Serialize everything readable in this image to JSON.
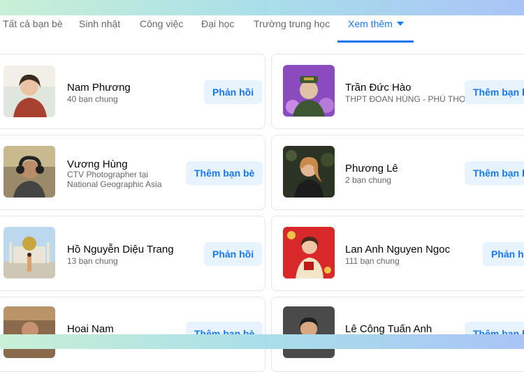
{
  "tabs": [
    {
      "label": "Tất cả bạn bè"
    },
    {
      "label": "Sinh nhật"
    },
    {
      "label": "Công việc"
    },
    {
      "label": "Đại học"
    },
    {
      "label": "Trường trung học"
    },
    {
      "label": "Xem thêm"
    }
  ],
  "colors": {
    "accent": "#1877f2",
    "button_bg": "#e7f3ff",
    "secondary_text": "#65676b"
  },
  "people": [
    {
      "name": "Nam Phương",
      "subtitle": "40 bạn chung",
      "button": "Phản hồi"
    },
    {
      "name": "Trần Đức Hào",
      "subtitle": "THPT ĐOAN HÙNG - PHÚ THỌ",
      "button": "Thêm bạn bè"
    },
    {
      "name": "Vương Hùng",
      "subtitle": "CTV Photographer tại National Geographic Asia",
      "button": "Thêm bạn bè"
    },
    {
      "name": "Phương Lê",
      "subtitle": "2 bạn chung",
      "button": "Thêm bạn bè"
    },
    {
      "name": "Hồ Nguyễn Diệu Trang",
      "subtitle": "13 bạn chung",
      "button": "Phản hồi"
    },
    {
      "name": "Lan Anh Nguyen Ngoc",
      "subtitle": "111 bạn chung",
      "button": "Phản hồi"
    },
    {
      "name": "Hoai Nam",
      "subtitle": "",
      "button": "Thêm bạn bè"
    },
    {
      "name": "Lê Công Tuấn Anh",
      "subtitle": "",
      "button": "Thêm bạn bè"
    }
  ]
}
